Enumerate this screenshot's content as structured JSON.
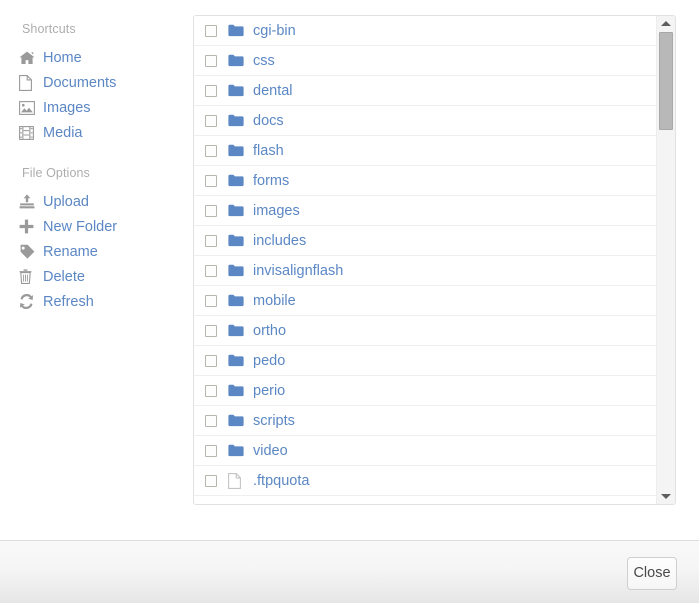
{
  "sidebar": {
    "sections": [
      {
        "title": "Shortcuts",
        "items": [
          {
            "label": "Home",
            "icon": "home-icon"
          },
          {
            "label": "Documents",
            "icon": "file-icon"
          },
          {
            "label": "Images",
            "icon": "picture-icon"
          },
          {
            "label": "Media",
            "icon": "film-icon"
          }
        ]
      },
      {
        "title": "File Options",
        "items": [
          {
            "label": "Upload",
            "icon": "upload-icon"
          },
          {
            "label": "New Folder",
            "icon": "plus-icon"
          },
          {
            "label": "Rename",
            "icon": "tag-icon"
          },
          {
            "label": "Delete",
            "icon": "trash-icon"
          },
          {
            "label": "Refresh",
            "icon": "refresh-icon"
          }
        ]
      }
    ]
  },
  "file_list": {
    "rows": [
      {
        "name": "cgi-bin",
        "type": "folder",
        "checked": false
      },
      {
        "name": "css",
        "type": "folder",
        "checked": false
      },
      {
        "name": "dental",
        "type": "folder",
        "checked": false
      },
      {
        "name": "docs",
        "type": "folder",
        "checked": false
      },
      {
        "name": "flash",
        "type": "folder",
        "checked": false
      },
      {
        "name": "forms",
        "type": "folder",
        "checked": false
      },
      {
        "name": "images",
        "type": "folder",
        "checked": false
      },
      {
        "name": "includes",
        "type": "folder",
        "checked": false
      },
      {
        "name": "invisalignflash",
        "type": "folder",
        "checked": false
      },
      {
        "name": "mobile",
        "type": "folder",
        "checked": false
      },
      {
        "name": "ortho",
        "type": "folder",
        "checked": false
      },
      {
        "name": "pedo",
        "type": "folder",
        "checked": false
      },
      {
        "name": "perio",
        "type": "folder",
        "checked": false
      },
      {
        "name": "scripts",
        "type": "folder",
        "checked": false
      },
      {
        "name": "video",
        "type": "folder",
        "checked": false
      },
      {
        "name": ".ftpquota",
        "type": "file",
        "checked": false
      }
    ]
  },
  "scrollbar": {
    "up_arrow_icon": "chevron-up-icon",
    "down_arrow_icon": "chevron-down-icon"
  },
  "footer": {
    "close_label": "Close"
  },
  "colors": {
    "link": "#5b87c4",
    "folder": "#5b87c4",
    "muted_label": "#adadad",
    "icon_gray": "#9a9a9a",
    "row_divider": "#efefef",
    "panel_border": "#e2e2e2"
  }
}
